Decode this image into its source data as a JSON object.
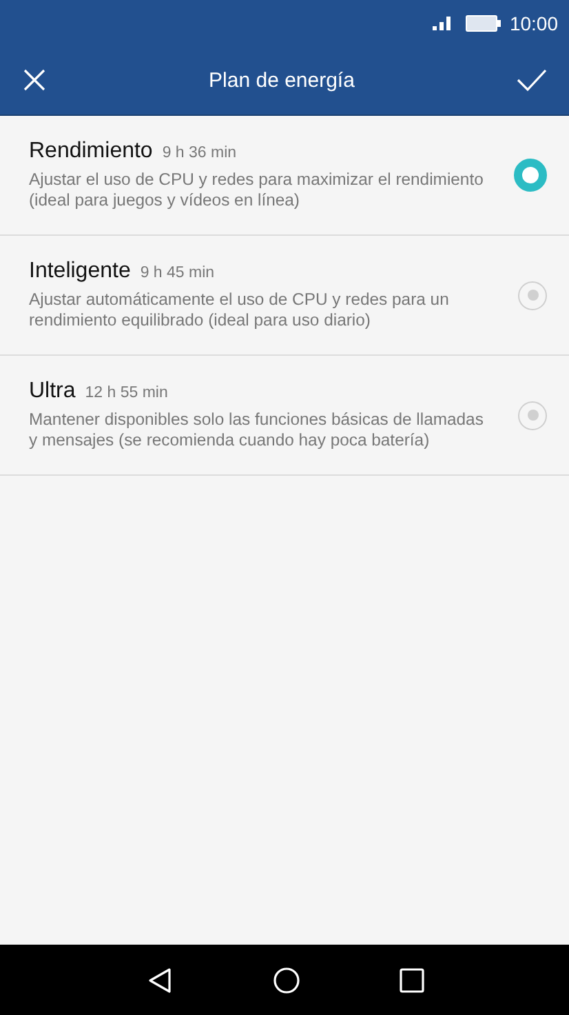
{
  "status_bar": {
    "time": "10:00"
  },
  "header": {
    "title": "Plan de energía"
  },
  "plans": [
    {
      "name": "Rendimiento",
      "duration": "9 h 36 min",
      "description": "Ajustar el uso de CPU y redes para maximizar el rendimiento (ideal para juegos y vídeos en línea)",
      "selected": true
    },
    {
      "name": "Inteligente",
      "duration": "9 h 45 min",
      "description": "Ajustar automáticamente el uso de CPU y redes para un rendimiento equilibrado (ideal para uso diario)",
      "selected": false
    },
    {
      "name": "Ultra",
      "duration": "12 h 55 min",
      "description": "Mantener disponibles solo las funciones básicas de llamadas y mensajes (se recomienda cuando hay poca batería)",
      "selected": false
    }
  ]
}
